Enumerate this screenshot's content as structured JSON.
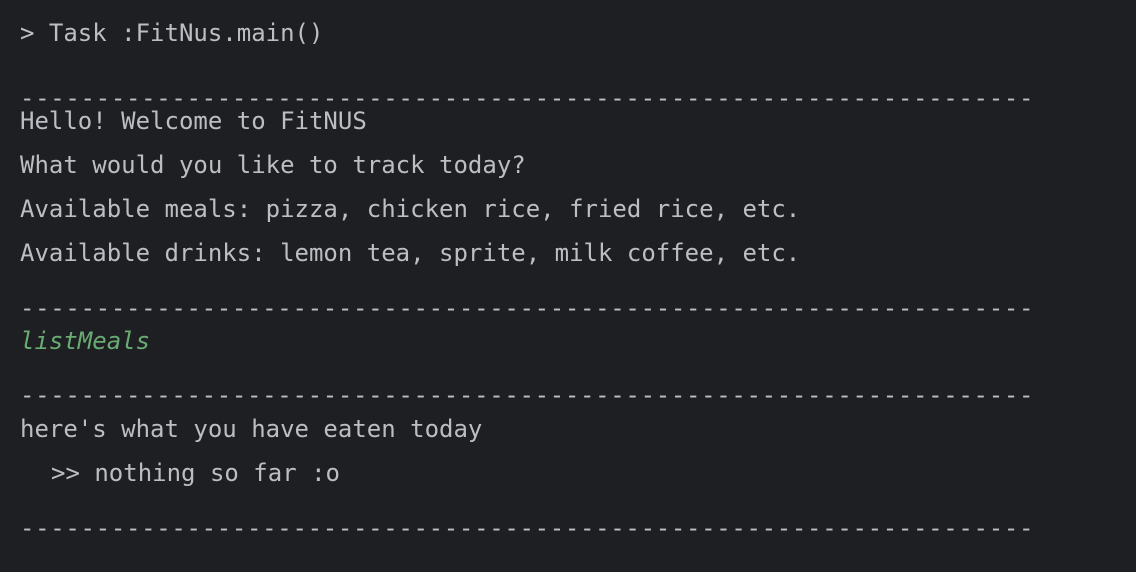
{
  "console": {
    "task_line": "> Task :FitNus.main()",
    "separator": "-------------------------------------------------------------------",
    "greeting": "Hello! Welcome to FitNUS",
    "prompt": "What would you like to track today?",
    "meals_line": "Available meals: pizza, chicken rice, fried rice, etc.",
    "drinks_line": "Available drinks: lemon tea, sprite, milk coffee, etc.",
    "user_input": "listMeals",
    "eaten_header": "here's what you have eaten today",
    "eaten_empty": ">> nothing so far :o"
  },
  "colors": {
    "background": "#1e1f22",
    "text": "#bcbec4",
    "user_input": "#6aab73"
  }
}
